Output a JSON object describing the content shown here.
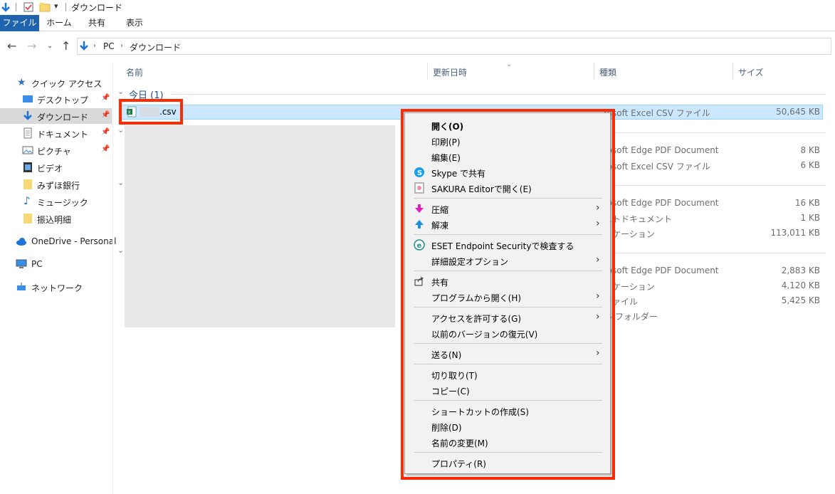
{
  "window": {
    "title": "ダウンロード"
  },
  "ribbon": {
    "tabs": [
      "ファイル",
      "ホーム",
      "共有",
      "表示"
    ]
  },
  "address": {
    "crumbs": [
      "PC",
      "ダウンロード"
    ]
  },
  "navpane": {
    "quick_access": "クイック アクセス",
    "items": [
      {
        "label": "デスクトップ",
        "pinned": true
      },
      {
        "label": "ダウンロード",
        "pinned": true,
        "selected": true
      },
      {
        "label": "ドキュメント",
        "pinned": true
      },
      {
        "label": "ピクチャ",
        "pinned": true
      },
      {
        "label": "ビデオ"
      },
      {
        "label": "みずほ銀行"
      },
      {
        "label": "ミュージック"
      },
      {
        "label": "振込明細"
      }
    ],
    "onedrive": "OneDrive - Personal",
    "pc": "PC",
    "network": "ネットワーク"
  },
  "columns": {
    "name": "名前",
    "modified": "更新日時",
    "type": "種類",
    "size": "サイズ"
  },
  "groups": {
    "today": "今日 (1)"
  },
  "selected_file": {
    "name": ".csv",
    "type": "rosoft Excel CSV ファイル",
    "size": "50,645 KB"
  },
  "visible_rows": [
    {
      "type": "rosoft Edge PDF Document",
      "size": "8 KB"
    },
    {
      "type": "rosoft Excel CSV ファイル",
      "size": "6 KB"
    },
    {
      "type": "rosoft Edge PDF Document",
      "size": "16 KB"
    },
    {
      "type": "ストドキュメント",
      "size": "1 KB"
    },
    {
      "type": "リケーション",
      "size": "113,011 KB"
    },
    {
      "type": "rosoft Edge PDF Document",
      "size": "2,883 KB"
    },
    {
      "type": "リケーション",
      "size": "4,120 KB"
    },
    {
      "type": "ファイル",
      "size": "5,425 KB"
    },
    {
      "type": "ル フォルダー",
      "size": ""
    }
  ],
  "context_menu": {
    "items": [
      {
        "label": "開く(O)",
        "bold": true
      },
      {
        "label": "印刷(P)"
      },
      {
        "label": "編集(E)"
      },
      {
        "label": "Skype で共有",
        "icon": "skype-icon"
      },
      {
        "label": "SAKURA Editorで開く(E)",
        "icon": "sakura-editor-icon"
      },
      {
        "label": "圧縮",
        "icon": "compress-arrow-icon",
        "submenu": true
      },
      {
        "label": "解凍",
        "icon": "extract-arrow-icon",
        "submenu": true
      },
      {
        "label": "ESET Endpoint Securityで検査する",
        "icon": "eset-icon"
      },
      {
        "label": "詳細設定オプション",
        "submenu": true
      },
      {
        "label": "共有",
        "icon": "share-icon"
      },
      {
        "label": "プログラムから開く(H)",
        "submenu": true
      },
      {
        "label": "アクセスを許可する(G)",
        "submenu": true
      },
      {
        "label": "以前のバージョンの復元(V)"
      },
      {
        "label": "送る(N)",
        "submenu": true
      },
      {
        "label": "切り取り(T)"
      },
      {
        "label": "コピー(C)"
      },
      {
        "label": "ショートカットの作成(S)"
      },
      {
        "label": "削除(D)"
      },
      {
        "label": "名前の変更(M)"
      },
      {
        "label": "プロパティ(R)"
      }
    ]
  },
  "colors": {
    "highlight": "#ff2a00",
    "selection": "#cce8ff",
    "ribbon_file": "#1e63ad"
  }
}
